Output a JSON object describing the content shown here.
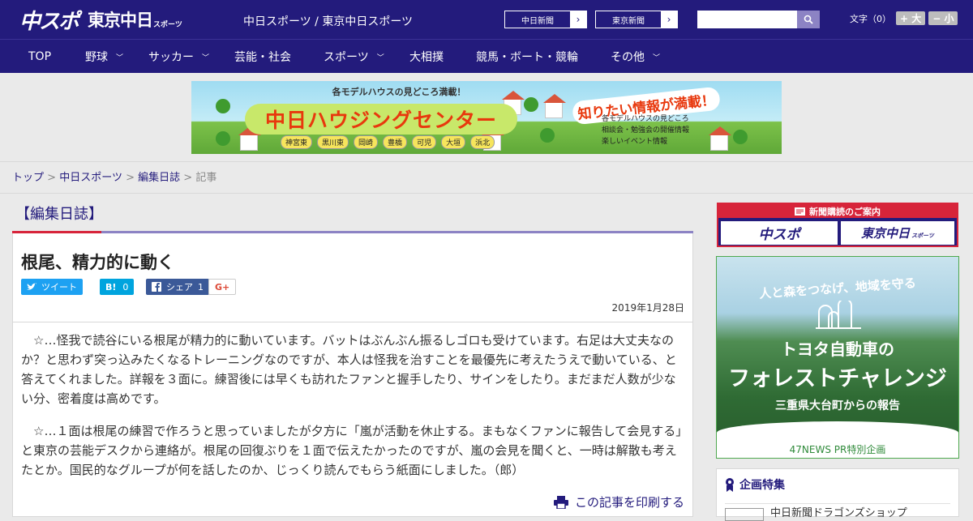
{
  "header": {
    "logo_primary": "中スポ",
    "logo_secondary": "東京中日",
    "logo_sub": "スポーツ",
    "site_name": "中日スポーツ / 東京中日スポーツ",
    "links": [
      {
        "label": "中日新聞",
        "arrow": "›"
      },
      {
        "label": "東京新聞",
        "arrow": "›"
      }
    ],
    "search_placeholder": "",
    "font_size_label": "文字（0）",
    "font_larger": "+ 大",
    "font_smaller": "− 小"
  },
  "nav": {
    "items": [
      {
        "label": "TOP",
        "chevron": ""
      },
      {
        "label": "野球",
        "chevron": "﹀"
      },
      {
        "label": "サッカー",
        "chevron": "﹀"
      },
      {
        "label": "芸能・社会",
        "chevron": ""
      },
      {
        "label": "スポーツ",
        "chevron": "﹀"
      },
      {
        "label": "大相撲",
        "chevron": ""
      },
      {
        "label": "競馬・ボート・競輪",
        "chevron": ""
      },
      {
        "label": "その他",
        "chevron": "﹀"
      }
    ]
  },
  "ad_banner": {
    "top_line": "各モデルハウスの見どころ満載！",
    "main": "中日ハウジングセンター",
    "right": "知りたい情報が満載！",
    "bullets": [
      "各モデルハウスの見どころ",
      "相談会・勉強会の開催情報",
      "楽しいイベント情報"
    ],
    "towns": [
      "神宮東",
      "黒川東",
      "岡崎",
      "豊橋",
      "可児",
      "大垣",
      "浜北"
    ]
  },
  "breadcrumb": {
    "items": [
      "トップ",
      "中日スポーツ",
      "編集日誌"
    ],
    "current": "記事",
    "sep": ">"
  },
  "article": {
    "category": "【編集日誌】",
    "title": "根尾、精力的に動く",
    "share": {
      "tweet": "ツイート",
      "hatena_label": "B!",
      "hatena_count": "0",
      "facebook_label": "シェア",
      "facebook_count": "1",
      "gplus": "G+"
    },
    "date": "2019年1月28日",
    "paragraphs": [
      "☆…怪我で読谷にいる根尾が精力的に動いています。バットはぶんぶん振るしゴロも受けています。右足は大丈夫なのか？と思わず突っ込みたくなるトレーニングなのですが、本人は怪我を治すことを最優先に考えたうえで動いている、と答えてくれました。詳報を３面に。練習後には早くも訪れたファンと握手したり、サインをしたり。まだまだ人数が少ない分、密着度は高めです。",
      "☆…１面は根尾の練習で作ろうと思っていましたが夕方に「嵐が活動を休止する。まもなくファンに報告して会見する」と東京の芸能デスクから連絡が。根尾の回復ぶりを１面で伝えたかったのですが、嵐の会見を聞くと、一時は解散も考えたとか。国民的なグループが何を話したのか、じっくり読んでもらう紙面にしました。（郎）"
    ],
    "print_label": "この記事を印刷する"
  },
  "sidebar": {
    "subscribe_header": "新聞購読のご案内",
    "subscribe_buttons": [
      "中スポ",
      "東京中日"
    ],
    "subscribe_sub": "スポーツ",
    "forest_ad": {
      "line1": "人と森をつなげ、地域を守る",
      "line2": "トヨタ自動車の",
      "line3": "フォレストチャレンジ",
      "line4": "三重県大台町からの報告",
      "footer": "47NEWS PR特別企画"
    },
    "feature_title": "企画特集",
    "feature_item": "中日新聞ドラゴンズショップ"
  },
  "colors": {
    "brand_navy": "#231b7c",
    "accent_red": "#d7243a",
    "accent_lavender": "#8c83c4",
    "twitter": "#1da1f2",
    "hatena": "#00a4de",
    "facebook": "#3b5998"
  }
}
